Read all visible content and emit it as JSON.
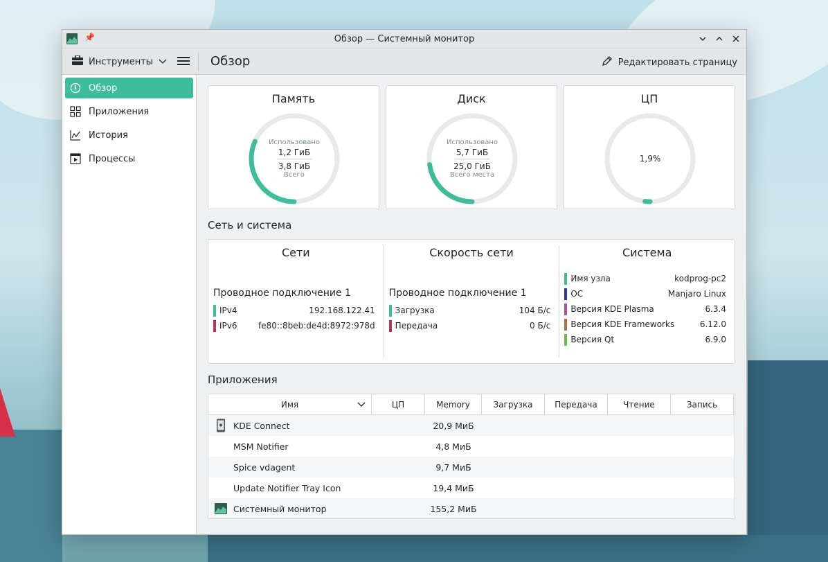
{
  "window": {
    "title": "Обзор — Системный монитор"
  },
  "toolbar": {
    "tools_label": "Инструменты",
    "page_title": "Обзор",
    "edit_label": "Редактировать страницу"
  },
  "sidebar": {
    "items": [
      {
        "label": "Обзор",
        "icon": "speedometer-icon",
        "active": true
      },
      {
        "label": "Приложения",
        "icon": "grid-icon",
        "active": false
      },
      {
        "label": "История",
        "icon": "chart-icon",
        "active": false
      },
      {
        "label": "Процессы",
        "icon": "process-icon",
        "active": false
      }
    ]
  },
  "cards": {
    "memory": {
      "title": "Память",
      "top_label": "Использовано",
      "used": "1,2 ГиБ",
      "total": "3,8 ГиБ",
      "bottom_label": "Всего",
      "fraction": 0.316
    },
    "disk": {
      "title": "Диск",
      "top_label": "Использовано",
      "used": "5,7 ГиБ",
      "total": "25,0 ГиБ",
      "bottom_label": "Всего места",
      "fraction": 0.228
    },
    "cpu": {
      "title": "ЦП",
      "value": "1,9%",
      "fraction": 0.019
    }
  },
  "network_section": {
    "title": "Сеть и система",
    "networks": {
      "title": "Сети",
      "connection": "Проводное подключение 1",
      "rows": [
        {
          "key": "IPv4",
          "value": "192.168.122.41",
          "color": "#3dbd9a"
        },
        {
          "key": "IPv6",
          "value": "fe80::8beb:de4d:8972:978d",
          "color": "#b03a55"
        }
      ]
    },
    "speed": {
      "title": "Скорость сети",
      "connection": "Проводное подключение 1",
      "rows": [
        {
          "key": "Загрузка",
          "value": "104 Б/с",
          "color": "#3dbd9a"
        },
        {
          "key": "Передача",
          "value": "0 Б/с",
          "color": "#b03a55"
        }
      ]
    },
    "system": {
      "title": "Система",
      "rows": [
        {
          "key": "Имя узла",
          "value": "kodprog-pc2",
          "color": "#3dbd9a"
        },
        {
          "key": "ОС",
          "value": "Manjaro Linux",
          "color": "#2c3aa0"
        },
        {
          "key": "Версия KDE Plasma",
          "value": "6.3.4",
          "color": "#b04fa4"
        },
        {
          "key": "Версия KDE Frameworks",
          "value": "6.12.0",
          "color": "#b86f45"
        },
        {
          "key": "Версия Qt",
          "value": "6.9.0",
          "color": "#6bbd49"
        }
      ]
    }
  },
  "apps_section": {
    "title": "Приложения",
    "columns": [
      "Имя",
      "ЦП",
      "Memory",
      "Загрузка",
      "Передача",
      "Чтение",
      "Запись"
    ],
    "rows": [
      {
        "name": "KDE Connect",
        "memory": "20,9 МиБ",
        "icon": "phone-icon"
      },
      {
        "name": "MSM Notifier",
        "memory": "4,8 МиБ",
        "icon": ""
      },
      {
        "name": "Spice vdagent",
        "memory": "9,7 МиБ",
        "icon": ""
      },
      {
        "name": "Update Notifier Tray Icon",
        "memory": "19,4 МиБ",
        "icon": ""
      },
      {
        "name": "Системный монитор",
        "memory": "155,2 МиБ",
        "icon": "system-monitor-icon"
      }
    ]
  },
  "colors": {
    "accent": "#3dbd9a",
    "gauge_track": "#e8e9ea"
  }
}
